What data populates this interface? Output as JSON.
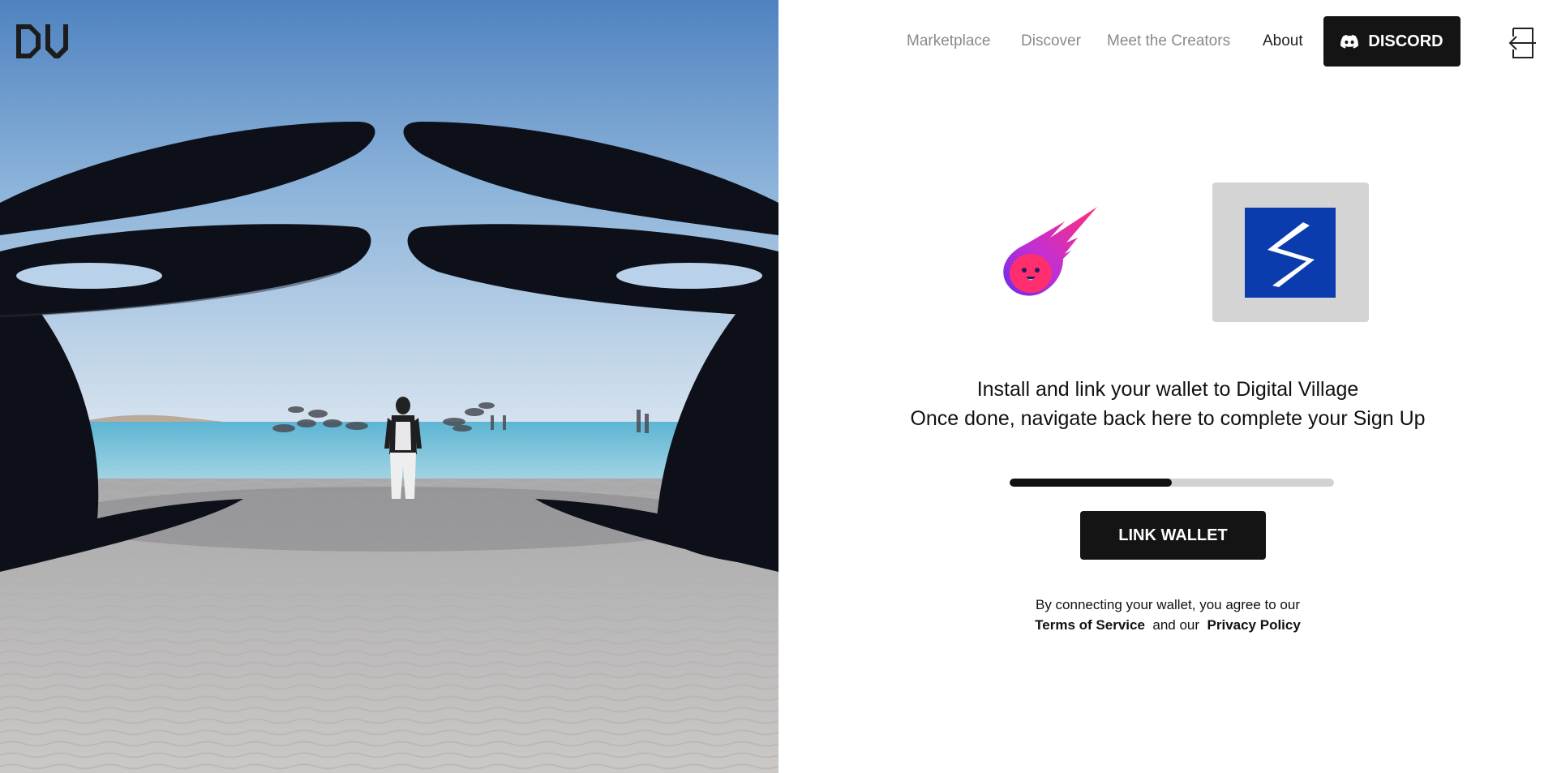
{
  "brand": {
    "logo_text": "DV"
  },
  "nav": {
    "links": [
      {
        "label": "Marketplace",
        "active": false
      },
      {
        "label": "Discover",
        "active": false
      },
      {
        "label": "Meet the Creators",
        "active": false
      },
      {
        "label": "About",
        "active": true
      }
    ],
    "discord_label": "DISCORD",
    "login_icon": "login-icon"
  },
  "wallets": [
    {
      "icon": "meteor-wallet-icon"
    },
    {
      "icon": "s-wallet-icon"
    }
  ],
  "instructions": {
    "line1": "Install and link your wallet to Digital Village",
    "line2": "Once done, navigate back here to complete your Sign Up"
  },
  "progress": {
    "value": 0.5
  },
  "link_wallet_label": "LINK WALLET",
  "legal": {
    "text": "By connecting your wallet, you agree to our",
    "terms": "Terms of Service",
    "and": "and our",
    "privacy": "Privacy Policy"
  },
  "colors": {
    "button_bg": "#141414",
    "wallet_tile_bg": "#d4d4d4",
    "wallet_blue": "#0a3cae",
    "progress_track": "#d2d2d2",
    "progress_fill": "#111111"
  }
}
